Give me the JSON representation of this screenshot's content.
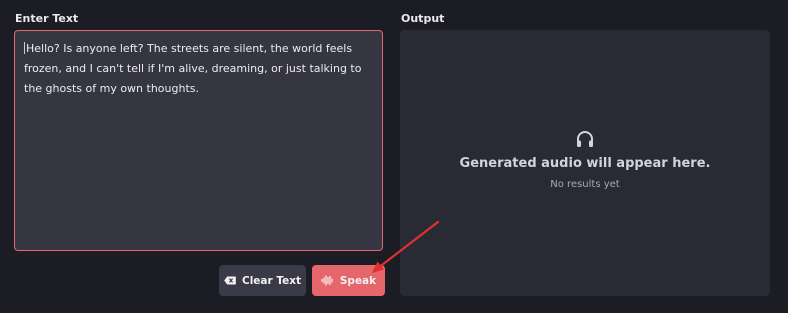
{
  "input": {
    "label": "Enter Text",
    "value": "Hello? Is anyone left? The streets are silent, the world feels frozen, and I can't tell if I'm alive, dreaming, or just talking to the ghosts of my own thoughts."
  },
  "output": {
    "label": "Output",
    "empty_title": "Generated audio will appear here.",
    "empty_subtitle": "No results yet",
    "icon": "headphones-icon"
  },
  "actions": {
    "clear_label": "Clear Text",
    "clear_icon": "backspace-icon",
    "speak_label": "Speak",
    "speak_icon": "sound-wave-icon"
  },
  "colors": {
    "accent": "#e5676b",
    "background": "#1c1c24",
    "panel": "#2a2a35",
    "annotation_arrow": "#e03030"
  }
}
